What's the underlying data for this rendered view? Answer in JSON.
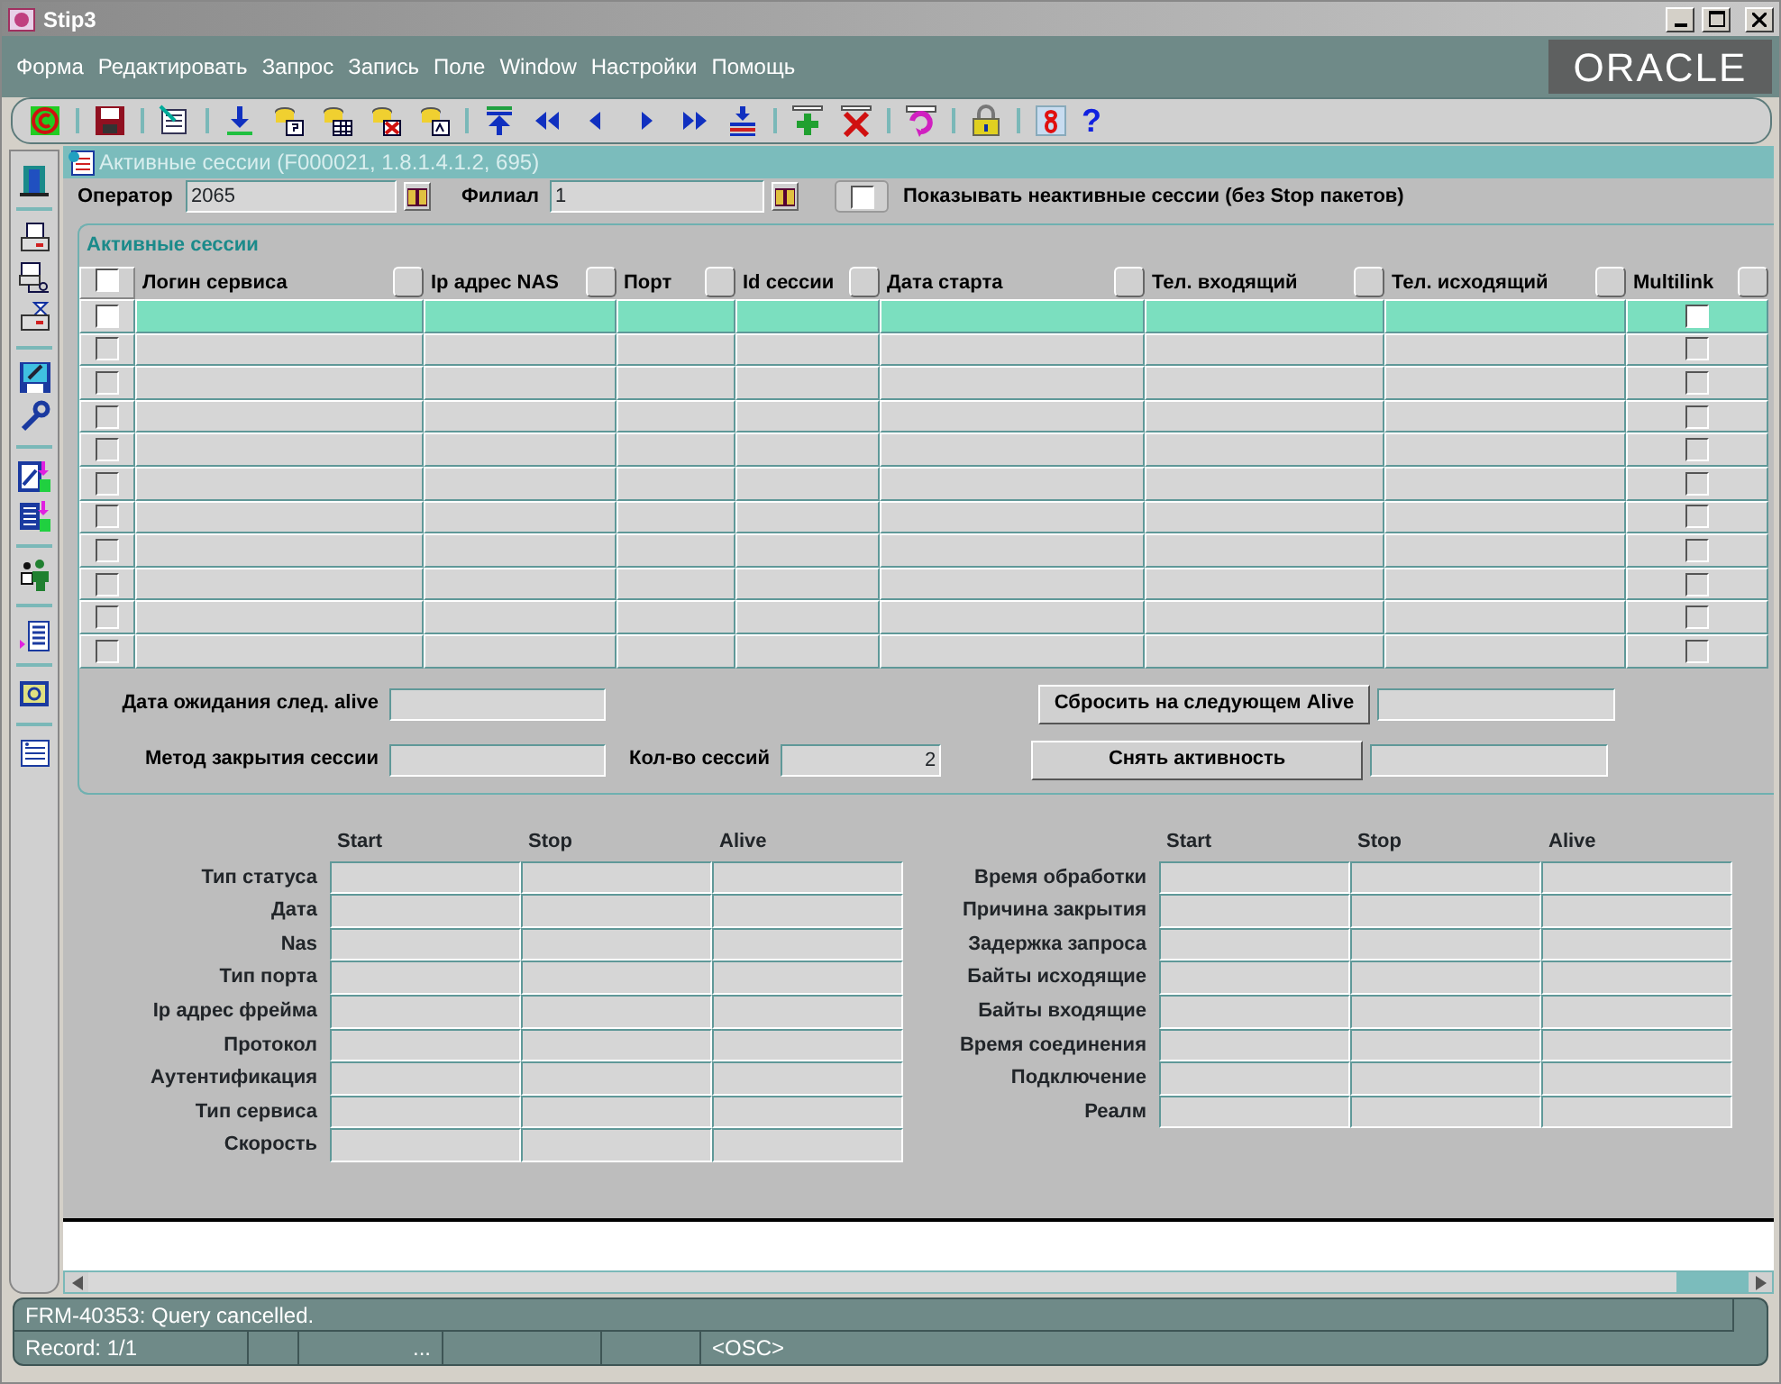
{
  "window": {
    "title": "Stip3"
  },
  "menu": [
    "Форма",
    "Редактировать",
    "Запрос",
    "Запись",
    "Поле",
    "Window",
    "Настройки",
    "Помощь"
  ],
  "logo": "ORACLE",
  "toolbar": {
    "help": "?"
  },
  "form": {
    "title": "Активные сессии (F000021, 1.8.1.4.1.2, 695)",
    "operator": {
      "label": "Оператор",
      "value": "2065"
    },
    "branch": {
      "label": "Филиал",
      "value": "1"
    },
    "show_inactive": {
      "label": "Показывать неактивные сессии (без Stop пакетов)",
      "checked": false
    }
  },
  "sessions": {
    "title": "Активные сессии",
    "select_all": {
      "checked": false
    },
    "columns": [
      "Логин сервиса",
      "Ip адрес NAS",
      "Порт",
      "Id сессии",
      "Дата старта",
      "Тел. входящий",
      "Тел. исходящий",
      "Multilink"
    ],
    "rows": [
      {
        "selected": true,
        "checked": false,
        "multilink": false
      },
      {
        "selected": false,
        "checked": false,
        "multilink": false
      },
      {
        "selected": false,
        "checked": false,
        "multilink": false
      },
      {
        "selected": false,
        "checked": false,
        "multilink": false
      },
      {
        "selected": false,
        "checked": false,
        "multilink": false
      },
      {
        "selected": false,
        "checked": false,
        "multilink": false
      },
      {
        "selected": false,
        "checked": false,
        "multilink": false
      },
      {
        "selected": false,
        "checked": false,
        "multilink": false
      },
      {
        "selected": false,
        "checked": false,
        "multilink": false
      },
      {
        "selected": false,
        "checked": false,
        "multilink": false
      },
      {
        "selected": false,
        "checked": false,
        "multilink": false
      }
    ],
    "next_alive": {
      "label": "Дата ожидания след. alive"
    },
    "close_method": {
      "label": "Метод закрытия сессии"
    },
    "session_count": {
      "label": "Кол-во сессий",
      "value": "2"
    },
    "buttons": [
      {
        "label": "Сбросить на следующем Alive"
      },
      {
        "label": "Снять активность"
      }
    ]
  },
  "details": [
    {
      "columns": [
        "Start",
        "Stop",
        "Alive"
      ],
      "rows": [
        "Тип статуса",
        "Дата",
        "Nas",
        "Тип порта",
        "Ip адрес фрейма",
        "Протокол",
        "Аутентификация",
        "Тип сервиса",
        "Скорость"
      ]
    },
    {
      "columns": [
        "Start",
        "Stop",
        "Alive"
      ],
      "rows": [
        "Время обработки",
        "Причина закрытия",
        "Задержка запроса",
        "Байты исходящие",
        "Байты входящие",
        "Время соединения",
        "Подключение",
        "Реалм"
      ]
    }
  ],
  "status_bar": {
    "message": "FRM-40353: Query cancelled.",
    "fields": [
      {
        "kind": "text",
        "text": "Record: 1/1"
      },
      {
        "kind": "blank"
      },
      {
        "kind": "text",
        "text": "..."
      },
      {
        "kind": "blank"
      },
      {
        "kind": "blank"
      },
      {
        "kind": "text",
        "text": "<OSC>"
      }
    ]
  }
}
